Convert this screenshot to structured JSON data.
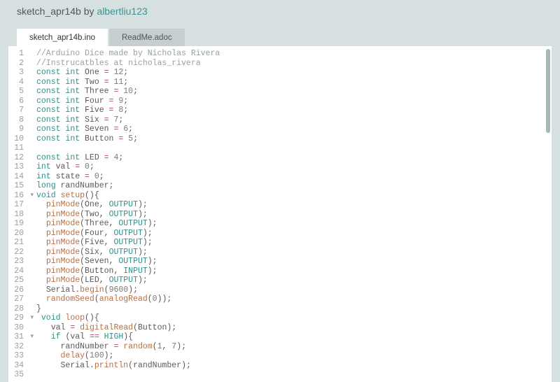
{
  "header": {
    "prefix": "sketch_apr14b by ",
    "author": "albertliu123"
  },
  "tabs": [
    {
      "label": "sketch_apr14b.ino",
      "active": true
    },
    {
      "label": "ReadMe.adoc",
      "active": false
    }
  ],
  "lines": [
    {
      "n": 1,
      "fold": false,
      "tokens": [
        [
          "cmt",
          "//Arduino Dice made by Nicholas Rivera"
        ]
      ]
    },
    {
      "n": 2,
      "fold": false,
      "tokens": [
        [
          "cmt",
          "//Instrucatbles at nicholas_rivera"
        ]
      ]
    },
    {
      "n": 3,
      "fold": false,
      "tokens": [
        [
          "kw",
          "const "
        ],
        [
          "kw",
          "int "
        ],
        [
          "ident",
          "One "
        ],
        [
          "op",
          "= "
        ],
        [
          "num",
          "12"
        ],
        [
          "punc",
          ";"
        ]
      ]
    },
    {
      "n": 4,
      "fold": false,
      "tokens": [
        [
          "kw",
          "const "
        ],
        [
          "kw",
          "int "
        ],
        [
          "ident",
          "Two "
        ],
        [
          "op",
          "= "
        ],
        [
          "num",
          "11"
        ],
        [
          "punc",
          ";"
        ]
      ]
    },
    {
      "n": 5,
      "fold": false,
      "tokens": [
        [
          "kw",
          "const "
        ],
        [
          "kw",
          "int "
        ],
        [
          "ident",
          "Three "
        ],
        [
          "op",
          "= "
        ],
        [
          "num",
          "10"
        ],
        [
          "punc",
          ";"
        ]
      ]
    },
    {
      "n": 6,
      "fold": false,
      "tokens": [
        [
          "kw",
          "const "
        ],
        [
          "kw",
          "int "
        ],
        [
          "ident",
          "Four "
        ],
        [
          "op",
          "= "
        ],
        [
          "num",
          "9"
        ],
        [
          "punc",
          ";"
        ]
      ]
    },
    {
      "n": 7,
      "fold": false,
      "tokens": [
        [
          "kw",
          "const "
        ],
        [
          "kw",
          "int "
        ],
        [
          "ident",
          "Five "
        ],
        [
          "op",
          "= "
        ],
        [
          "num",
          "8"
        ],
        [
          "punc",
          ";"
        ]
      ]
    },
    {
      "n": 8,
      "fold": false,
      "tokens": [
        [
          "kw",
          "const "
        ],
        [
          "kw",
          "int "
        ],
        [
          "ident",
          "Six "
        ],
        [
          "op",
          "= "
        ],
        [
          "num",
          "7"
        ],
        [
          "punc",
          ";"
        ]
      ]
    },
    {
      "n": 9,
      "fold": false,
      "tokens": [
        [
          "kw",
          "const "
        ],
        [
          "kw",
          "int "
        ],
        [
          "ident",
          "Seven "
        ],
        [
          "op",
          "= "
        ],
        [
          "num",
          "6"
        ],
        [
          "punc",
          ";"
        ]
      ]
    },
    {
      "n": 10,
      "fold": false,
      "tokens": [
        [
          "kw",
          "const "
        ],
        [
          "kw",
          "int "
        ],
        [
          "ident",
          "Button "
        ],
        [
          "op",
          "= "
        ],
        [
          "num",
          "5"
        ],
        [
          "punc",
          ";"
        ]
      ]
    },
    {
      "n": 11,
      "fold": false,
      "tokens": []
    },
    {
      "n": 12,
      "fold": false,
      "tokens": [
        [
          "kw",
          "const "
        ],
        [
          "kw",
          "int "
        ],
        [
          "ident",
          "LED "
        ],
        [
          "op",
          "= "
        ],
        [
          "num",
          "4"
        ],
        [
          "punc",
          ";"
        ]
      ]
    },
    {
      "n": 13,
      "fold": false,
      "tokens": [
        [
          "kw",
          "int "
        ],
        [
          "ident",
          "val "
        ],
        [
          "op",
          "= "
        ],
        [
          "num",
          "0"
        ],
        [
          "punc",
          ";"
        ]
      ]
    },
    {
      "n": 14,
      "fold": false,
      "tokens": [
        [
          "kw",
          "int "
        ],
        [
          "ident",
          "state "
        ],
        [
          "op",
          "= "
        ],
        [
          "num",
          "0"
        ],
        [
          "punc",
          ";"
        ]
      ]
    },
    {
      "n": 15,
      "fold": false,
      "tokens": [
        [
          "kw",
          "long "
        ],
        [
          "ident",
          "randNumber"
        ],
        [
          "punc",
          ";"
        ]
      ]
    },
    {
      "n": 16,
      "fold": true,
      "tokens": [
        [
          "kw",
          "void "
        ],
        [
          "fn",
          "setup"
        ],
        [
          "punc",
          "(){"
        ]
      ]
    },
    {
      "n": 17,
      "fold": false,
      "tokens": [
        [
          "ident",
          "  "
        ],
        [
          "fn",
          "pinMode"
        ],
        [
          "punc",
          "("
        ],
        [
          "ident",
          "One"
        ],
        [
          "punc",
          ", "
        ],
        [
          "const",
          "OUTPUT"
        ],
        [
          "punc",
          ");"
        ]
      ]
    },
    {
      "n": 18,
      "fold": false,
      "tokens": [
        [
          "ident",
          "  "
        ],
        [
          "fn",
          "pinMode"
        ],
        [
          "punc",
          "("
        ],
        [
          "ident",
          "Two"
        ],
        [
          "punc",
          ", "
        ],
        [
          "const",
          "OUTPUT"
        ],
        [
          "punc",
          ");"
        ]
      ]
    },
    {
      "n": 19,
      "fold": false,
      "tokens": [
        [
          "ident",
          "  "
        ],
        [
          "fn",
          "pinMode"
        ],
        [
          "punc",
          "("
        ],
        [
          "ident",
          "Three"
        ],
        [
          "punc",
          ", "
        ],
        [
          "const",
          "OUTPUT"
        ],
        [
          "punc",
          ");"
        ]
      ]
    },
    {
      "n": 20,
      "fold": false,
      "tokens": [
        [
          "ident",
          "  "
        ],
        [
          "fn",
          "pinMode"
        ],
        [
          "punc",
          "("
        ],
        [
          "ident",
          "Four"
        ],
        [
          "punc",
          ", "
        ],
        [
          "const",
          "OUTPUT"
        ],
        [
          "punc",
          ");"
        ]
      ]
    },
    {
      "n": 21,
      "fold": false,
      "tokens": [
        [
          "ident",
          "  "
        ],
        [
          "fn",
          "pinMode"
        ],
        [
          "punc",
          "("
        ],
        [
          "ident",
          "Five"
        ],
        [
          "punc",
          ", "
        ],
        [
          "const",
          "OUTPUT"
        ],
        [
          "punc",
          ");"
        ]
      ]
    },
    {
      "n": 22,
      "fold": false,
      "tokens": [
        [
          "ident",
          "  "
        ],
        [
          "fn",
          "pinMode"
        ],
        [
          "punc",
          "("
        ],
        [
          "ident",
          "Six"
        ],
        [
          "punc",
          ", "
        ],
        [
          "const",
          "OUTPUT"
        ],
        [
          "punc",
          ");"
        ]
      ]
    },
    {
      "n": 23,
      "fold": false,
      "tokens": [
        [
          "ident",
          "  "
        ],
        [
          "fn",
          "pinMode"
        ],
        [
          "punc",
          "("
        ],
        [
          "ident",
          "Seven"
        ],
        [
          "punc",
          ", "
        ],
        [
          "const",
          "OUTPUT"
        ],
        [
          "punc",
          ");"
        ]
      ]
    },
    {
      "n": 24,
      "fold": false,
      "tokens": [
        [
          "ident",
          "  "
        ],
        [
          "fn",
          "pinMode"
        ],
        [
          "punc",
          "("
        ],
        [
          "ident",
          "Button"
        ],
        [
          "punc",
          ", "
        ],
        [
          "const",
          "INPUT"
        ],
        [
          "punc",
          ");"
        ]
      ]
    },
    {
      "n": 25,
      "fold": false,
      "tokens": [
        [
          "ident",
          "  "
        ],
        [
          "fn",
          "pinMode"
        ],
        [
          "punc",
          "("
        ],
        [
          "ident",
          "LED"
        ],
        [
          "punc",
          ", "
        ],
        [
          "const",
          "OUTPUT"
        ],
        [
          "punc",
          ");"
        ]
      ]
    },
    {
      "n": 26,
      "fold": false,
      "tokens": [
        [
          "ident",
          "  "
        ],
        [
          "ident",
          "Serial"
        ],
        [
          "punc",
          "."
        ],
        [
          "fn",
          "begin"
        ],
        [
          "punc",
          "("
        ],
        [
          "num",
          "9600"
        ],
        [
          "punc",
          ");"
        ]
      ]
    },
    {
      "n": 27,
      "fold": false,
      "tokens": [
        [
          "ident",
          "  "
        ],
        [
          "fn",
          "randomSeed"
        ],
        [
          "punc",
          "("
        ],
        [
          "fn",
          "analogRead"
        ],
        [
          "punc",
          "("
        ],
        [
          "num",
          "0"
        ],
        [
          "punc",
          "));"
        ]
      ]
    },
    {
      "n": 28,
      "fold": false,
      "tokens": [
        [
          "punc",
          "}"
        ]
      ]
    },
    {
      "n": 29,
      "fold": true,
      "tokens": [
        [
          "ident",
          " "
        ],
        [
          "kw",
          "void "
        ],
        [
          "fn",
          "loop"
        ],
        [
          "punc",
          "(){"
        ]
      ]
    },
    {
      "n": 30,
      "fold": false,
      "tokens": [
        [
          "ident",
          "   "
        ],
        [
          "ident",
          "val "
        ],
        [
          "op",
          "= "
        ],
        [
          "fn",
          "digitalRead"
        ],
        [
          "punc",
          "("
        ],
        [
          "ident",
          "Button"
        ],
        [
          "punc",
          ");"
        ]
      ]
    },
    {
      "n": 31,
      "fold": true,
      "tokens": [
        [
          "ident",
          "   "
        ],
        [
          "kw",
          "if "
        ],
        [
          "punc",
          "("
        ],
        [
          "ident",
          "val "
        ],
        [
          "op",
          "== "
        ],
        [
          "const",
          "HIGH"
        ],
        [
          "punc",
          "){"
        ]
      ]
    },
    {
      "n": 32,
      "fold": false,
      "tokens": [
        [
          "ident",
          "     "
        ],
        [
          "ident",
          "randNumber "
        ],
        [
          "op",
          "= "
        ],
        [
          "fn",
          "random"
        ],
        [
          "punc",
          "("
        ],
        [
          "num",
          "1"
        ],
        [
          "punc",
          ", "
        ],
        [
          "num",
          "7"
        ],
        [
          "punc",
          ");"
        ]
      ]
    },
    {
      "n": 33,
      "fold": false,
      "tokens": [
        [
          "ident",
          "     "
        ],
        [
          "fn",
          "delay"
        ],
        [
          "punc",
          "("
        ],
        [
          "num",
          "100"
        ],
        [
          "punc",
          ");"
        ]
      ]
    },
    {
      "n": 34,
      "fold": false,
      "tokens": [
        [
          "ident",
          "     "
        ],
        [
          "ident",
          "Serial"
        ],
        [
          "punc",
          "."
        ],
        [
          "fn",
          "println"
        ],
        [
          "punc",
          "("
        ],
        [
          "ident",
          "randNumber"
        ],
        [
          "punc",
          ");"
        ]
      ]
    },
    {
      "n": 35,
      "fold": false,
      "tokens": []
    }
  ]
}
